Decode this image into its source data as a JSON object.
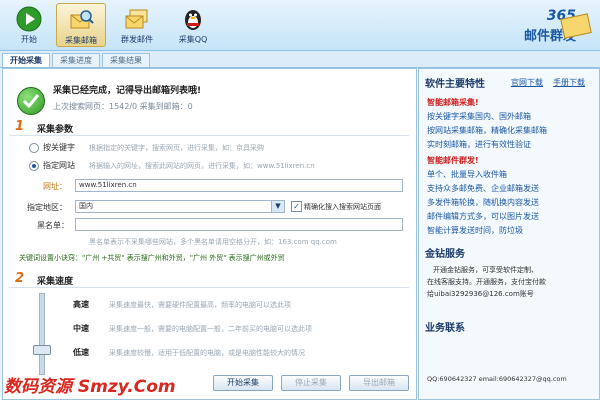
{
  "toolbar": {
    "start": "开始",
    "collect_email": "采集邮箱",
    "mass_send": "群发邮件",
    "collect_qq": "采集QQ"
  },
  "brand": {
    "num": "365",
    "text": "邮件群发"
  },
  "tabs": [
    "开始采集",
    "采集进度",
    "采集结果"
  ],
  "status": {
    "title": "采集已经完成，记得导出邮箱列表哦!",
    "stats": "上次搜索网页：1542/0  采集到邮箱：0"
  },
  "section1": {
    "num": "1",
    "title": "采集参数",
    "option_keyword": "按关键字",
    "option_keyword_hint": "根据指定的关键字，搜索网页，进行采集，如：京具采购",
    "option_url": "指定网站",
    "option_url_hint": "将据输入的网址，搜索此网站的网页，进行采集，如：www.51lixren.cn",
    "url_label": "网址：",
    "url_value": "www.51lixren.cn",
    "region_label": "指定地区：",
    "region_value": "国内",
    "filter_label": "精确化搜入搜索网站页面",
    "filter_checked": true,
    "blacklist_label": "黑名单：",
    "blacklist_hint": "黑名单表示不采集哪些网站，多个黑名单请用空格分开，如：163.com qq.com",
    "keyword_tip": "关键词设置小诀窍：\"广州 +共贸\" 表示搜广州和外贸，\"广州 外贸\" 表示搜广州或外贸"
  },
  "section2": {
    "num": "2",
    "title": "采集速度",
    "speeds": [
      {
        "label": "高速",
        "desc": "采集速度最快，需要硬件配置最高，频率的电脑可以选此项"
      },
      {
        "label": "中速",
        "desc": "采集速度一般，需要的电脑配置一般，二年前买的电脑可以选此项"
      },
      {
        "label": "低速",
        "desc": "采集速度较慢，适用于低配置的电脑，或是电脑性能较大的情况"
      }
    ],
    "slider_level": "低速"
  },
  "buttons": {
    "start": "开始采集",
    "stop": "停止采集",
    "export": "导出邮箱"
  },
  "sidebar": {
    "title": "软件主要特性",
    "link_official": "官网下载",
    "link_manual": "手册下载",
    "features": [
      {
        "text": "智能邮箱采集!",
        "red": true
      },
      {
        "text": "按关键字采集国内、国外邮箱",
        "red": false
      },
      {
        "text": "按网站采集邮箱，精确化采集邮箱",
        "red": false
      },
      {
        "text": "实时刻邮箱，进行有效性验证",
        "red": false
      },
      {
        "text": "智能邮件群发!",
        "red": true
      },
      {
        "text": "单个、批量导入收件箱",
        "red": false
      },
      {
        "text": "支持众多邮免费、企业邮箱发送",
        "red": false
      },
      {
        "text": "多发件箱轮换，随机换内容发送",
        "red": false
      },
      {
        "text": "邮件编辑方式多，可以图片发送",
        "red": false
      },
      {
        "text": "智能计算发送时间，防垃圾",
        "red": false
      }
    ],
    "service_title": "金钻服务",
    "service_lines": [
      "开通金钻服务，可享受软件定制、",
      "在线客服支持。开通服务，支付宝付款",
      "给uibai3292936@126.com账号"
    ],
    "contact_title": "业务联系",
    "contact_line": "QQ:690642327  email:690642327@qq.com"
  },
  "watermark": "数码资源 Smzy.Com"
}
